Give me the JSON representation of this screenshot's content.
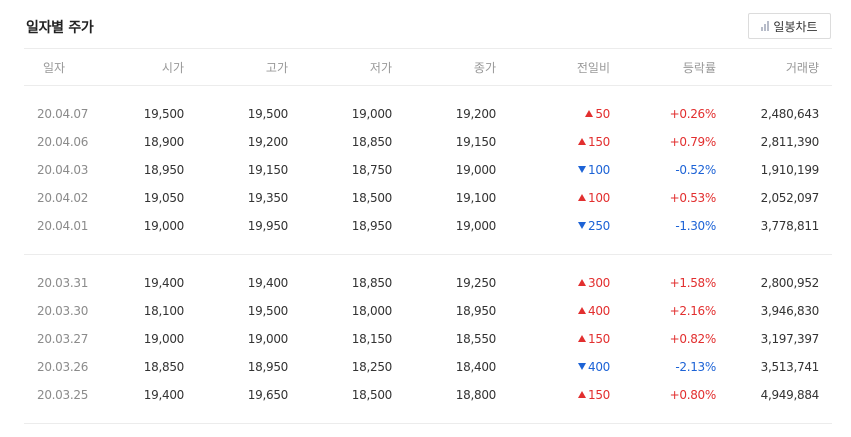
{
  "title": "일자별 주가",
  "chart_button": {
    "label": "일봉차트",
    "icon": "bar-chart-icon"
  },
  "columns": [
    "일자",
    "시가",
    "고가",
    "저가",
    "종가",
    "전일비",
    "등락률",
    "거래량"
  ],
  "colors": {
    "up": "#e22f2f",
    "down": "#1d63d6"
  },
  "groups": [
    [
      {
        "date": "20.04.07",
        "open": "19,500",
        "high": "19,500",
        "low": "19,000",
        "close": "19,200",
        "dir": "up",
        "change": "50",
        "rate": "+0.26%",
        "volume": "2,480,643"
      },
      {
        "date": "20.04.06",
        "open": "18,900",
        "high": "19,200",
        "low": "18,850",
        "close": "19,150",
        "dir": "up",
        "change": "150",
        "rate": "+0.79%",
        "volume": "2,811,390"
      },
      {
        "date": "20.04.03",
        "open": "18,950",
        "high": "19,150",
        "low": "18,750",
        "close": "19,000",
        "dir": "down",
        "change": "100",
        "rate": "-0.52%",
        "volume": "1,910,199"
      },
      {
        "date": "20.04.02",
        "open": "19,050",
        "high": "19,350",
        "low": "18,500",
        "close": "19,100",
        "dir": "up",
        "change": "100",
        "rate": "+0.53%",
        "volume": "2,052,097"
      },
      {
        "date": "20.04.01",
        "open": "19,000",
        "high": "19,950",
        "low": "18,950",
        "close": "19,000",
        "dir": "down",
        "change": "250",
        "rate": "-1.30%",
        "volume": "3,778,811"
      }
    ],
    [
      {
        "date": "20.03.31",
        "open": "19,400",
        "high": "19,400",
        "low": "18,850",
        "close": "19,250",
        "dir": "up",
        "change": "300",
        "rate": "+1.58%",
        "volume": "2,800,952"
      },
      {
        "date": "20.03.30",
        "open": "18,100",
        "high": "19,500",
        "low": "18,000",
        "close": "18,950",
        "dir": "up",
        "change": "400",
        "rate": "+2.16%",
        "volume": "3,946,830"
      },
      {
        "date": "20.03.27",
        "open": "19,000",
        "high": "19,000",
        "low": "18,150",
        "close": "18,550",
        "dir": "up",
        "change": "150",
        "rate": "+0.82%",
        "volume": "3,197,397"
      },
      {
        "date": "20.03.26",
        "open": "18,850",
        "high": "18,950",
        "low": "18,250",
        "close": "18,400",
        "dir": "down",
        "change": "400",
        "rate": "-2.13%",
        "volume": "3,513,741"
      },
      {
        "date": "20.03.25",
        "open": "19,400",
        "high": "19,650",
        "low": "18,500",
        "close": "18,800",
        "dir": "up",
        "change": "150",
        "rate": "+0.80%",
        "volume": "4,949,884"
      }
    ]
  ]
}
